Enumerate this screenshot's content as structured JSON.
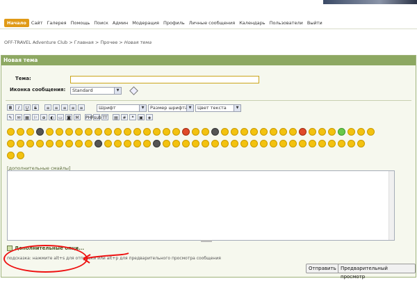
{
  "nav": {
    "items": [
      "Начало",
      "Сайт",
      "Галерея",
      "Помощь",
      "Поиск",
      "Админ",
      "Модерация",
      "Профиль",
      "Личные сообщения",
      "Календарь",
      "Пользователи",
      "Выйти"
    ]
  },
  "breadcrumb": {
    "links": [
      "OFF-TRAVEL Adventure Club",
      "Главная",
      "Прочее"
    ],
    "current": "Новая тема"
  },
  "panel": {
    "title": "Новая тема",
    "subject_label": "Тема:",
    "icon_label": "Иконка сообщения:",
    "icon_value": "Standard",
    "font_select": "Шрифт",
    "size_select": "Размер шрифта",
    "color_select": "Цвет текста",
    "more_smilies": "[дополнительные смайлы]",
    "advanced": "Дополнительные опци...",
    "hint": "подсказка: нажмите alt+s для отправки или alt+p для предварительного просмотра сообщения",
    "submit": "Отправить",
    "preview": "Предварительный просмотр"
  },
  "toolbar": {
    "row1": [
      "B",
      "I",
      "U",
      "S",
      "≡",
      "≡",
      "≡",
      "≡",
      "≡"
    ],
    "row2": [
      "✎",
      "✉",
      "▦",
      "⚐",
      "⊕",
      "◐",
      "▭",
      "◙",
      "M",
      "PHP",
      "sub",
      "TT",
      "▤",
      "#",
      "❝",
      "▣",
      "◈"
    ]
  },
  "colors": {
    "accent": "#e09a17",
    "panel_head": "#8da862",
    "annotation": "#e11"
  }
}
